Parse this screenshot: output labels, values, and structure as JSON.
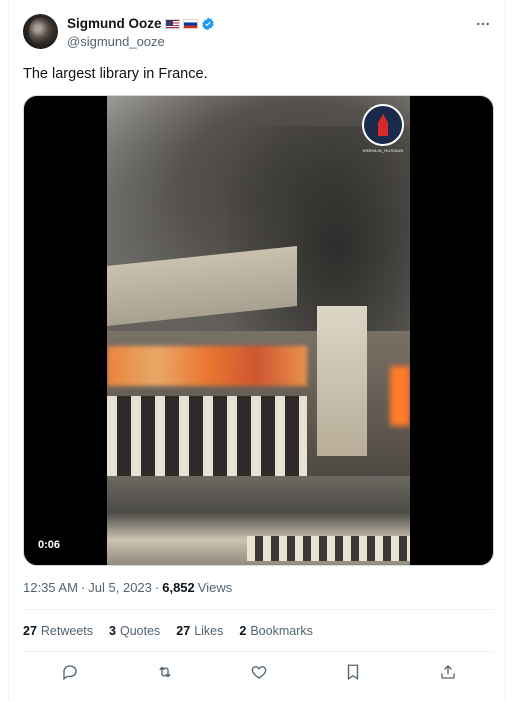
{
  "author": {
    "display_name": "Sigmund Ooze",
    "handle": "@sigmund_ooze",
    "flags": [
      "us-flag-icon",
      "ru-flag-icon"
    ],
    "verified_color": "#1d9bf0"
  },
  "tweet": {
    "text": "The largest library in France.",
    "media": {
      "duration": "0:06",
      "watermark": "KREMLIN_RUSSIAN"
    },
    "time": "12:35 AM",
    "sep1": "·",
    "date": "Jul 5, 2023",
    "sep2": "·",
    "views_count": "6,852",
    "views_label": "Views"
  },
  "stats": {
    "retweets_count": "27",
    "retweets_label": "Retweets",
    "quotes_count": "3",
    "quotes_label": "Quotes",
    "likes_count": "27",
    "likes_label": "Likes",
    "bookmarks_count": "2",
    "bookmarks_label": "Bookmarks"
  },
  "actions": [
    "reply-icon",
    "retweet-icon",
    "like-icon",
    "bookmark-icon",
    "share-icon"
  ],
  "colors": {
    "text": "#0f1419",
    "muted": "#536471",
    "border": "#eff3f4",
    "accent": "#1d9bf0"
  }
}
